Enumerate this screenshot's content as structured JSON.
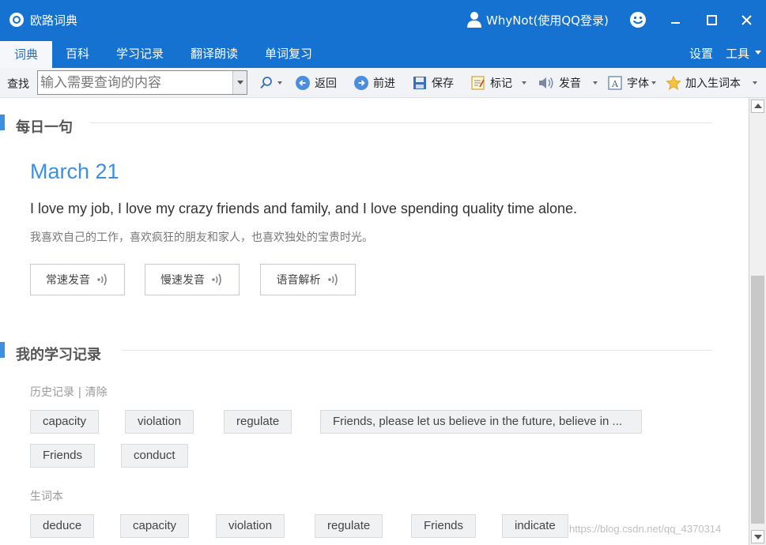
{
  "window": {
    "title": "欧路词典",
    "user": "WhyNot(使用QQ登录)"
  },
  "tabs": [
    {
      "label": "词典",
      "active": true
    },
    {
      "label": "百科"
    },
    {
      "label": "学习记录"
    },
    {
      "label": "翻译朗读"
    },
    {
      "label": "单词复习"
    }
  ],
  "tab_right": {
    "settings": "设置",
    "tools": "工具"
  },
  "toolbar": {
    "search_label": "查找",
    "search_placeholder": "输入需要查询的内容",
    "back": "返回",
    "forward": "前进",
    "save": "保存",
    "mark": "标记",
    "pronounce": "发音",
    "font": "字体",
    "add_wordbook": "加入生词本"
  },
  "daily": {
    "section_title": "每日一句",
    "date": "March 21",
    "sentence_en": "I love my job, I love my crazy friends and family, and I love spending quality time alone.",
    "sentence_cn": "我喜欢自己的工作，喜欢疯狂的朋友和家人，也喜欢独处的宝贵时光。",
    "buttons": [
      "常速发音",
      "慢速发音",
      "语音解析"
    ]
  },
  "records": {
    "section_title": "我的学习记录",
    "history_label": "历史记录 |",
    "clear_label": "清除",
    "history": [
      "capacity",
      "violation",
      "regulate",
      "Friends, please let us believe in the future, believe in ...",
      "Friends",
      "conduct"
    ],
    "wordbook_label": "生词本",
    "wordbook": [
      "deduce",
      "capacity",
      "violation",
      "regulate",
      "Friends",
      "indicate"
    ]
  },
  "watermark": "https://blog.csdn.net/qq_4370314",
  "colors": {
    "accent": "#1672d0",
    "link": "#3d8fe0"
  }
}
